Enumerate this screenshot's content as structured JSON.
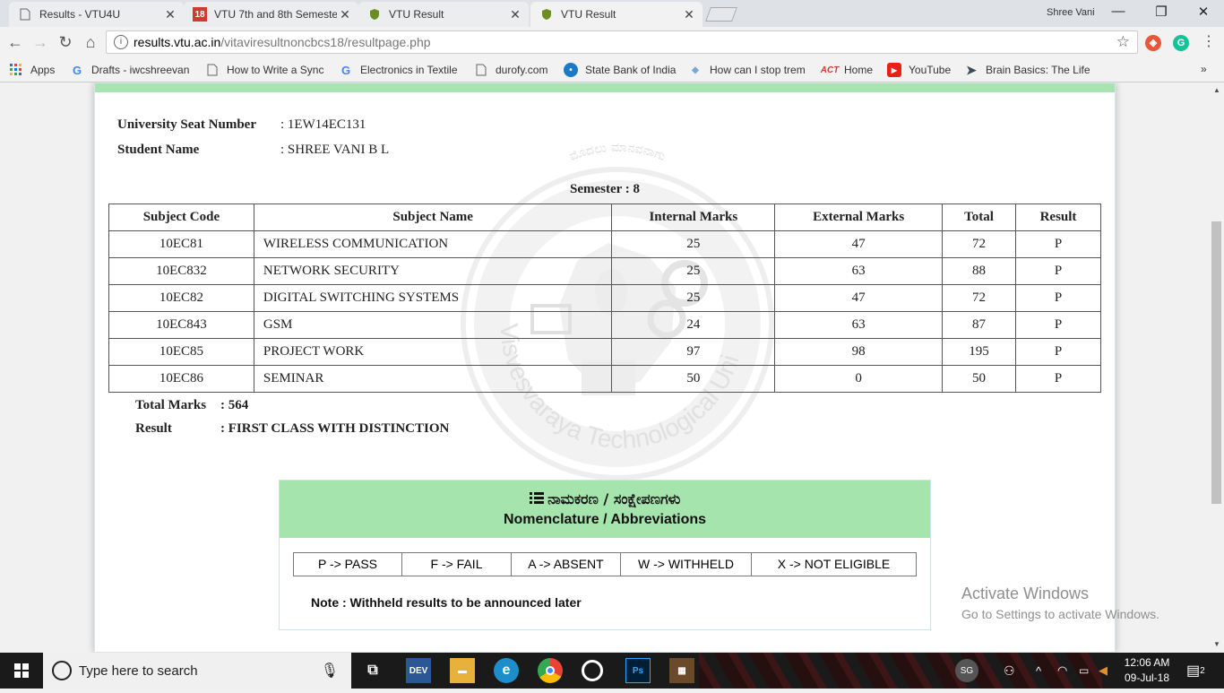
{
  "browser": {
    "tabs": [
      {
        "title": "Results - VTU4U",
        "icon": "page-icon"
      },
      {
        "title": "VTU 7th and 8th Semeste",
        "icon": "badge-18-icon"
      },
      {
        "title": "VTU Result",
        "icon": "shield-icon"
      },
      {
        "title": "VTU Result",
        "icon": "shield-icon"
      }
    ],
    "profile_name": "Shree Vani",
    "url_host": "results.vtu.ac.in",
    "url_path": "/vitaviresultnoncbcs18/resultpage.php",
    "bookmarks": [
      {
        "label": "Apps",
        "icon": "apps-grid-icon"
      },
      {
        "label": "Drafts - iwcshreevan",
        "icon": "google-icon"
      },
      {
        "label": "How to Write a Sync",
        "icon": "page-icon"
      },
      {
        "label": "Electronics in Textile",
        "icon": "google-icon"
      },
      {
        "label": "durofy.com",
        "icon": "page-icon"
      },
      {
        "label": "State Bank of India",
        "icon": "sbi-icon"
      },
      {
        "label": "How can I stop trem",
        "icon": "shield-icon"
      },
      {
        "label": "Home",
        "icon": "act-icon"
      },
      {
        "label": "YouTube",
        "icon": "youtube-icon"
      },
      {
        "label": "Brain Basics: The Life",
        "icon": "arrow-icon"
      }
    ],
    "bookmark_overflow": "»"
  },
  "student": {
    "seat_label": "University Seat Number",
    "seat_value": ": 1EW14EC131",
    "name_label": "Student Name",
    "name_value": ": SHREE VANI B L",
    "semester": "Semester : 8"
  },
  "table": {
    "headers": [
      "Subject Code",
      "Subject Name",
      "Internal Marks",
      "External Marks",
      "Total",
      "Result"
    ],
    "rows": [
      {
        "code": "10EC81",
        "name": "WIRELESS COMMUNICATION",
        "internal": "25",
        "external": "47",
        "total": "72",
        "result": "P"
      },
      {
        "code": "10EC832",
        "name": "NETWORK SECURITY",
        "internal": "25",
        "external": "63",
        "total": "88",
        "result": "P"
      },
      {
        "code": "10EC82",
        "name": "DIGITAL SWITCHING SYSTEMS",
        "internal": "25",
        "external": "47",
        "total": "72",
        "result": "P"
      },
      {
        "code": "10EC843",
        "name": "GSM",
        "internal": "24",
        "external": "63",
        "total": "87",
        "result": "P"
      },
      {
        "code": "10EC85",
        "name": "PROJECT WORK",
        "internal": "97",
        "external": "98",
        "total": "195",
        "result": "P"
      },
      {
        "code": "10EC86",
        "name": "SEMINAR",
        "internal": "50",
        "external": "0",
        "total": "50",
        "result": "P"
      }
    ]
  },
  "summary": {
    "total_label": "Total Marks",
    "total_value": ": 564",
    "result_label": "Result",
    "result_value": ": FIRST CLASS WITH DISTINCTION"
  },
  "nomenclature": {
    "title_kannada": "ನಾಮಕರಣ / ಸಂಕ್ಷೇಪಣಗಳು",
    "title_english": "Nomenclature / Abbreviations",
    "legend": [
      "P -> PASS",
      "F -> FAIL",
      "A -> ABSENT",
      "W -> WITHHELD",
      "X -> NOT ELIGIBLE"
    ],
    "note": "Note : Withheld results to be announced later"
  },
  "watermark_text": {
    "top": "ಮೊದಲು ಮಾನವನಾಗು",
    "ring": "Visvesvaraya Technological University, Belgaum"
  },
  "activation": {
    "line1": "Activate Windows",
    "line2": "Go to Settings to activate Windows."
  },
  "taskbar": {
    "search_placeholder": "Type here to search",
    "user_initials": "SG",
    "time": "12:06 AM",
    "date": "09-Jul-18",
    "notification_count": "2"
  }
}
